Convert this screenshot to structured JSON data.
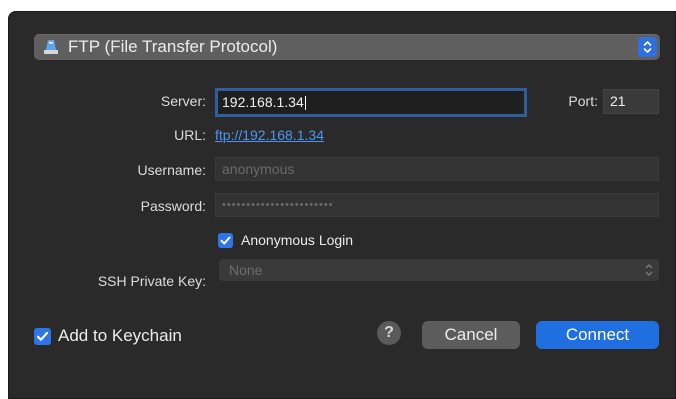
{
  "protocol": {
    "selected": "FTP (File Transfer Protocol)",
    "icon": "ftp-server-icon"
  },
  "server": {
    "label": "Server:",
    "value": "192.168.1.34"
  },
  "port": {
    "label": "Port:",
    "value": "21"
  },
  "url": {
    "label": "URL:",
    "value": "ftp://192.168.1.34"
  },
  "username": {
    "label": "Username:",
    "value": "anonymous"
  },
  "password": {
    "label": "Password:",
    "value": "•••••••••••••••••••••••"
  },
  "anonymous_login": {
    "label": "Anonymous Login",
    "checked": true
  },
  "ssh_key": {
    "label": "SSH Private Key:",
    "value": "None"
  },
  "keychain": {
    "label": "Add to Keychain",
    "checked": true
  },
  "buttons": {
    "help": "?",
    "cancel": "Cancel",
    "connect": "Connect"
  },
  "colors": {
    "accent": "#1f6fe0",
    "link": "#4d95f5",
    "background": "#2a2a2a"
  }
}
